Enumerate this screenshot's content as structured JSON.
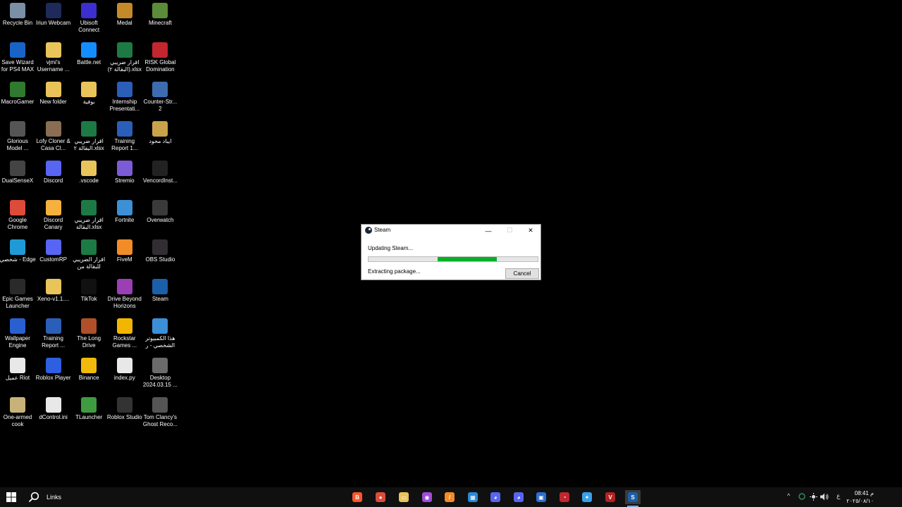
{
  "colors": {
    "desktop_bg": "#000000",
    "taskbar_bg": "#101010",
    "progress": "#06b025"
  },
  "desktop_icons": [
    {
      "label": "Recycle Bin",
      "icon": "recycle-bin-icon",
      "color": "#7b8fa6"
    },
    {
      "label": "Iriun Webcam",
      "icon": "webcam-icon",
      "color": "#1d2a5a"
    },
    {
      "label": "Ubisoft Connect",
      "icon": "ubisoft-icon",
      "color": "#3b2fd0"
    },
    {
      "label": "Medal",
      "icon": "medal-icon",
      "color": "#c48a2a"
    },
    {
      "label": "Minecraft",
      "icon": "minecraft-icon",
      "color": "#5b8c3a"
    },
    {
      "label": "Save Wizard for PS4 MAX",
      "icon": "save-wizard-icon",
      "color": "#1a63c6"
    },
    {
      "label": "vjmi's Username ...",
      "icon": "folder-icon",
      "color": "#e8c45a"
    },
    {
      "label": "Battle.net",
      "icon": "battlenet-icon",
      "color": "#148eff"
    },
    {
      "label": "اقرار ضريبي (البقالة ٢).xlsx",
      "icon": "excel-icon",
      "color": "#1d7a45"
    },
    {
      "label": "RISK Global Domination",
      "icon": "risk-icon",
      "color": "#c2262e"
    },
    {
      "label": "MacroGamer",
      "icon": "macrogamer-icon",
      "color": "#2f7a2f"
    },
    {
      "label": "New folder",
      "icon": "folder-icon",
      "color": "#e8c45a"
    },
    {
      "label": "بوفية",
      "icon": "folder-icon",
      "color": "#e8c45a"
    },
    {
      "label": "Internship Presentati...",
      "icon": "word-icon",
      "color": "#2b5eb8"
    },
    {
      "label": "Counter-Str... 2",
      "icon": "counter-strike-icon",
      "color": "#3c6bb0"
    },
    {
      "label": "Glorious Model ...",
      "icon": "glorious-icon",
      "color": "#555555"
    },
    {
      "label": "Lofy Cloner & Casa Cl...",
      "icon": "lofy-icon",
      "color": "#8a6d52"
    },
    {
      "label": "اقرار ضريبي البقالة ٢.xlsx",
      "icon": "excel-icon",
      "color": "#1d7a45"
    },
    {
      "label": "Training Report 1...",
      "icon": "word-icon",
      "color": "#2b5eb8"
    },
    {
      "label": "ايباد محود",
      "icon": "folder-icon",
      "color": "#c9a24a"
    },
    {
      "label": "DualSenseX",
      "icon": "dualsensex-icon",
      "color": "#444444"
    },
    {
      "label": "Discord",
      "icon": "discord-icon",
      "color": "#5865f2"
    },
    {
      "label": ".vscode",
      "icon": "folder-icon",
      "color": "#e8c45a"
    },
    {
      "label": "Stremio",
      "icon": "stremio-icon",
      "color": "#7b5bd6"
    },
    {
      "label": "VencordInst...",
      "icon": "vencord-icon",
      "color": "#222222"
    },
    {
      "label": "Google Chrome",
      "icon": "chrome-icon",
      "color": "#dd4b39"
    },
    {
      "label": "Discord Canary",
      "icon": "discord-canary-icon",
      "color": "#f5b13d"
    },
    {
      "label": "اقرار ضريبي البقالة.xlsx",
      "icon": "excel-icon",
      "color": "#1d7a45"
    },
    {
      "label": "Fortnite",
      "icon": "fortnite-icon",
      "color": "#3d8fd6"
    },
    {
      "label": "Overwatch",
      "icon": "overwatch-icon",
      "color": "#3a3a3a"
    },
    {
      "label": "شخصي - Edge",
      "icon": "edge-icon",
      "color": "#1e9bd7"
    },
    {
      "label": "CustomRP",
      "icon": "customrp-icon",
      "color": "#5865f2"
    },
    {
      "label": "اقرار الضريبي للبقالة من",
      "icon": "excel-icon",
      "color": "#1d7a45"
    },
    {
      "label": "FiveM",
      "icon": "fivem-icon",
      "color": "#f28c28"
    },
    {
      "label": "OBS Studio",
      "icon": "obs-icon",
      "color": "#302e31"
    },
    {
      "label": "Epic Games Launcher",
      "icon": "epic-games-icon",
      "color": "#2a2a2a"
    },
    {
      "label": "Xeno-v1.1....",
      "icon": "folder-icon",
      "color": "#e8c45a"
    },
    {
      "label": "TikTok",
      "icon": "tiktok-icon",
      "color": "#111111"
    },
    {
      "label": "Drive Beyond Horizons",
      "icon": "drive-beyond-icon",
      "color": "#9b3fb5"
    },
    {
      "label": "Steam",
      "icon": "steam-icon",
      "color": "#1b5fa8"
    },
    {
      "label": "Wallpaper Engine",
      "icon": "wallpaper-engine-icon",
      "color": "#2a5fd0"
    },
    {
      "label": "Training Report ...",
      "icon": "word-icon",
      "color": "#2b5eb8"
    },
    {
      "label": "The Long Drive",
      "icon": "long-drive-icon",
      "color": "#b0502a"
    },
    {
      "label": "Rockstar Games ...",
      "icon": "rockstar-icon",
      "color": "#f2b600"
    },
    {
      "label": "هذا الكمبيوتر الشخصي - ر",
      "icon": "this-pc-icon",
      "color": "#3a8fd8"
    },
    {
      "label": "عميل Riot",
      "icon": "document-icon",
      "color": "#e8e8e8"
    },
    {
      "label": "Roblox Player",
      "icon": "roblox-icon",
      "color": "#2d5fe0"
    },
    {
      "label": "Binance",
      "icon": "binance-icon",
      "color": "#f0b90b"
    },
    {
      "label": "index.py",
      "icon": "python-file-icon",
      "color": "#e8e8e8"
    },
    {
      "label": "Desktop 2024.03.15 ...",
      "icon": "screenshot-icon",
      "color": "#6b6b6b"
    },
    {
      "label": "One-armed cook",
      "icon": "one-armed-cook-icon",
      "color": "#c8b27a"
    },
    {
      "label": "dControl.ini",
      "icon": "ini-file-icon",
      "color": "#e8e8e8"
    },
    {
      "label": "TLauncher",
      "icon": "tlauncher-icon",
      "color": "#3f9b3f"
    },
    {
      "label": "Roblox Studio",
      "icon": "roblox-studio-icon",
      "color": "#333333"
    },
    {
      "label": "Tom Clancy's Ghost Reco...",
      "icon": "ghost-recon-icon",
      "color": "#555555"
    }
  ],
  "steam_dialog": {
    "title": "Steam",
    "status": "Updating Steam...",
    "detail": "Extracting package...",
    "cancel_label": "Cancel",
    "progress_start": 0.41,
    "progress_end": 0.76,
    "minimize": "—",
    "maximize": "☐",
    "close": "✕"
  },
  "taskbar": {
    "links_label": "Links",
    "apps": [
      {
        "name": "brave-icon",
        "color": "#fb542b",
        "glyph": "B"
      },
      {
        "name": "chrome-icon",
        "color": "#dd4b39",
        "glyph": "●"
      },
      {
        "name": "file-explorer-icon",
        "color": "#e8c45a",
        "glyph": "▭"
      },
      {
        "name": "messenger-icon",
        "color": "#a04bd8",
        "glyph": "◉"
      },
      {
        "name": "fivem-icon",
        "color": "#f28c28",
        "glyph": "/"
      },
      {
        "name": "microsoft-store-icon",
        "color": "#2b88d8",
        "glyph": "▦"
      },
      {
        "name": "discord-icon",
        "color": "#5865f2",
        "glyph": "◕"
      },
      {
        "name": "discord-canary-icon",
        "color": "#5865f2",
        "glyph": "◕"
      },
      {
        "name": "remote-desktop-icon",
        "color": "#2b6fd0",
        "glyph": "▣"
      },
      {
        "name": "speedometer-icon",
        "color": "#c2262e",
        "glyph": "◔"
      },
      {
        "name": "copilot-icon",
        "color": "#3aa0e8",
        "glyph": "✦"
      },
      {
        "name": "voicemeeter-icon",
        "color": "#b22222",
        "glyph": "V"
      },
      {
        "name": "steam-icon",
        "color": "#1b5fa8",
        "glyph": "S"
      }
    ],
    "tray": {
      "chevron": "^",
      "language": "ع"
    },
    "clock": {
      "time": "08:41 م",
      "date": "٢٠٢٥/٠٨/١٠"
    }
  }
}
